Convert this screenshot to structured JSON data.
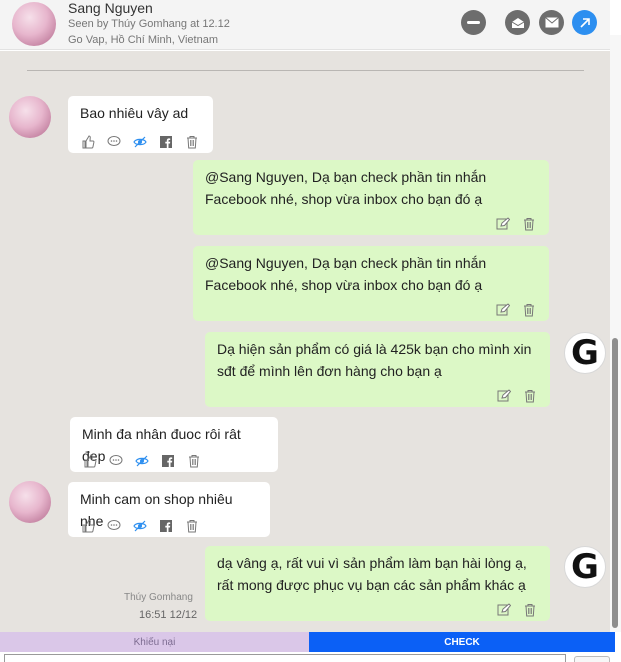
{
  "header": {
    "name": "Sang Nguyen",
    "seen": "Seen by Thúy Gomhang at 12.12",
    "location": "Go Vap, Hồ Chí Minh, Vietnam",
    "buttons": [
      "block-icon",
      "mail-open-icon",
      "mail-icon",
      "external-link-icon"
    ]
  },
  "messages": [
    {
      "side": "in",
      "text": "Bao nhiêu vây ad",
      "icons": [
        "like-icon",
        "comment-icon",
        "hide-icon",
        "facebook-icon",
        "trash-icon"
      ]
    },
    {
      "side": "out",
      "text": "@Sang Nguyen, Dạ bạn check phần tin nhắn Facebook nhé, shop vừa inbox cho bạn đó ạ",
      "icons": [
        "edit-icon",
        "trash-icon"
      ]
    },
    {
      "side": "out",
      "text": "@Sang Nguyen, Dạ bạn check phần tin nhắn Facebook nhé, shop vừa inbox cho bạn đó ạ",
      "icons": [
        "edit-icon",
        "trash-icon"
      ]
    },
    {
      "side": "out",
      "text": "Dạ hiện sản phẩm có giá là 425k bạn cho mình xin sđt để mình lên đơn hàng cho bạn ạ",
      "avatar": "G",
      "icons": [
        "edit-icon",
        "trash-icon"
      ]
    },
    {
      "side": "in",
      "text": "Minh đa nhân đuoc rôi rât đep",
      "icons": [
        "like-icon",
        "comment-icon",
        "hide-icon",
        "facebook-icon",
        "trash-icon"
      ]
    },
    {
      "side": "in",
      "text": "Minh cam on shop nhiêu nhe",
      "icons": [
        "like-icon",
        "comment-icon",
        "hide-icon",
        "facebook-icon",
        "trash-icon"
      ]
    },
    {
      "side": "out",
      "text": "dạ vâng ạ, rất vui vì sản phẩm làm bạn hài lòng ạ, rất mong được phục vụ bạn các sản phẩm khác ạ",
      "avatar": "G",
      "icons": [
        "edit-icon",
        "trash-icon"
      ]
    }
  ],
  "last_meta": {
    "author": "Thúy Gomhang",
    "time": "16:51 12/12"
  },
  "tabs": {
    "complaint": "Khiếu nại",
    "check": "CHECK"
  },
  "colors": {
    "incoming": "#ffffff",
    "outgoing": "#dcf8c6",
    "chat_bg": "#e6e3df",
    "check_tab": "#0b60f6",
    "complaint_tab": "#dac7e8",
    "accent": "#2d8ff0"
  }
}
